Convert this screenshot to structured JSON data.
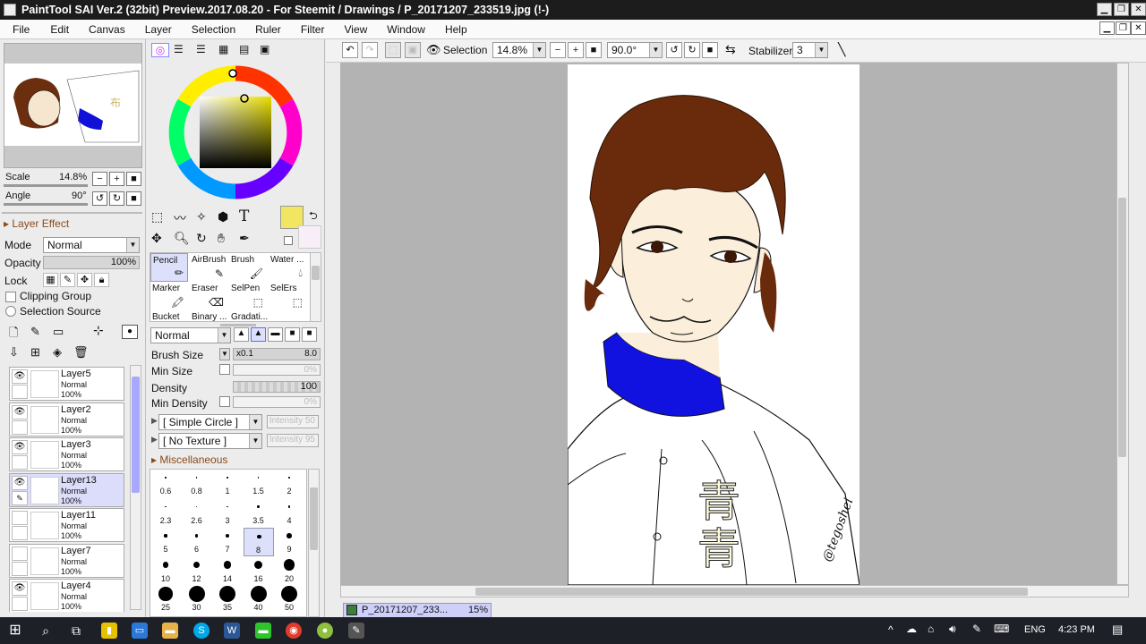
{
  "window": {
    "title": "PaintTool SAI Ver.2 (32bit) Preview.2017.08.20 - For Steemit / Drawings / P_20171207_233519.jpg (!-)"
  },
  "menu": [
    "File",
    "Edit",
    "Canvas",
    "Layer",
    "Selection",
    "Ruler",
    "Filter",
    "View",
    "Window",
    "Help"
  ],
  "navigator": {
    "scale_label": "Scale",
    "scale_value": "14.8%",
    "angle_label": "Angle",
    "angle_value": "90°"
  },
  "layer_effect": {
    "title": "Layer Effect",
    "mode_label": "Mode",
    "mode_value": "Normal",
    "opacity_label": "Opacity",
    "opacity_value": "100%",
    "lock_label": "Lock",
    "clipping_label": "Clipping Group",
    "selection_source_label": "Selection Source"
  },
  "layers": [
    {
      "name": "Layer5",
      "mode": "Normal",
      "opacity": "100%",
      "visible": true,
      "selected": false
    },
    {
      "name": "Layer2",
      "mode": "Normal",
      "opacity": "100%",
      "visible": true,
      "selected": false
    },
    {
      "name": "Layer3",
      "mode": "Normal",
      "opacity": "100%",
      "visible": true,
      "selected": false
    },
    {
      "name": "Layer13",
      "mode": "Normal",
      "opacity": "100%",
      "visible": true,
      "selected": true
    },
    {
      "name": "Layer11",
      "mode": "Normal",
      "opacity": "100%",
      "visible": false,
      "selected": false
    },
    {
      "name": "Layer7",
      "mode": "Normal",
      "opacity": "100%",
      "visible": false,
      "selected": false
    },
    {
      "name": "Layer4",
      "mode": "Normal",
      "opacity": "100%",
      "visible": true,
      "selected": false
    }
  ],
  "colors": {
    "primary": "#f2e562",
    "secondary": "#f7eef8",
    "accent_selection": "#dcdcfb",
    "canvas_bg": "#b3b3b3"
  },
  "tools": [
    {
      "label": "Pencil",
      "selected": true
    },
    {
      "label": "AirBrush"
    },
    {
      "label": "Brush"
    },
    {
      "label": "Water ..."
    },
    {
      "label": "Marker"
    },
    {
      "label": "Eraser"
    },
    {
      "label": "SelPen"
    },
    {
      "label": "SelErs"
    },
    {
      "label": "Bucket"
    },
    {
      "label": "Binary ..."
    },
    {
      "label": "Gradati..."
    }
  ],
  "brush": {
    "blend_value": "Normal",
    "size_label": "Brush Size",
    "size_mult": "x0.1",
    "size_value": "8.0",
    "min_size_label": "Min Size",
    "min_size_value": "0%",
    "density_label": "Density",
    "density_value": "100",
    "min_density_label": "Min Density",
    "min_density_value": "0%",
    "shape_value": "[ Simple Circle ]",
    "shape_intensity": "Intensity 50",
    "texture_value": "[ No Texture ]",
    "texture_intensity": "Intensity 95",
    "misc_label": "Miscellaneous"
  },
  "brush_sizes": [
    "0.6",
    "0.8",
    "1",
    "1.5",
    "2",
    "2.3",
    "2.6",
    "3",
    "3.5",
    "4",
    "5",
    "6",
    "7",
    "8",
    "9",
    "10",
    "12",
    "14",
    "16",
    "20",
    "25",
    "30",
    "35",
    "40",
    "50"
  ],
  "selected_brush_size": "8",
  "canvas_toolbar": {
    "selection_label": "Selection",
    "zoom_value": "14.8%",
    "rotation_value": "90.0°",
    "stabilizer_label": "Stabilizer",
    "stabilizer_value": "3"
  },
  "doc_tab": {
    "name": "P_20171207_233...",
    "zoom": "15%"
  },
  "taskbar": {
    "lang": "ENG",
    "time": "4:23 PM"
  }
}
